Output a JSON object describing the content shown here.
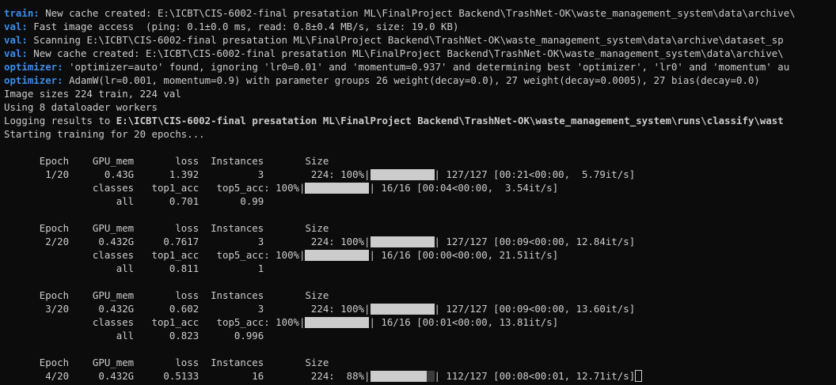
{
  "log": [
    {
      "prefix": "train:",
      "text": " New cache created: E:\\ICBT\\CIS-6002-final presatation ML\\FinalProject Backend\\TrashNet-OK\\waste_management_system\\data\\archive\\"
    },
    {
      "prefix": "val:",
      "text": " Fast image access  (ping: 0.1±0.0 ms, read: 0.8±0.4 MB/s, size: 19.0 KB)"
    },
    {
      "prefix": "val:",
      "text": " Scanning E:\\ICBT\\CIS-6002-final presatation ML\\FinalProject Backend\\TrashNet-OK\\waste_management_system\\data\\archive\\dataset_sp"
    },
    {
      "prefix": "val:",
      "text": " New cache created: E:\\ICBT\\CIS-6002-final presatation ML\\FinalProject Backend\\TrashNet-OK\\waste_management_system\\data\\archive\\"
    },
    {
      "prefix": "optimizer:",
      "text": " 'optimizer=auto' found, ignoring 'lr0=0.01' and 'momentum=0.937' and determining best 'optimizer', 'lr0' and 'momentum' au"
    },
    {
      "prefix": "optimizer:",
      "text": " AdamW(lr=0.001, momentum=0.9) with parameter groups 26 weight(decay=0.0), 27 weight(decay=0.0005), 27 bias(decay=0.0)"
    },
    {
      "prefix": "",
      "text": "Image sizes 224 train, 224 val"
    },
    {
      "prefix": "",
      "text": "Using 8 dataloader workers"
    },
    {
      "prefix": "",
      "text": "Logging results to ",
      "bold": "E:\\ICBT\\CIS-6002-final presatation ML\\FinalProject Backend\\TrashNet-OK\\waste_management_system\\runs\\classify\\wast"
    },
    {
      "prefix": "",
      "text": "Starting training for 20 epochs..."
    }
  ],
  "epochs": [
    {
      "header": "      Epoch    GPU_mem       loss  Instances       Size",
      "train_left": "       1/20      0.43G      1.392          3        224: 100%|",
      "train_progress": 1.0,
      "train_right": "| 127/127 [00:21<00:00,  5.79it/s]",
      "val_left": "               classes   top1_acc   top5_acc: 100%|",
      "val_progress": 1.0,
      "val_right": "| 16/16 [00:04<00:00,  3.54it/s]",
      "metrics": "                   all      0.701       0.99"
    },
    {
      "header": "      Epoch    GPU_mem       loss  Instances       Size",
      "train_left": "       2/20     0.432G     0.7617          3        224: 100%|",
      "train_progress": 1.0,
      "train_right": "| 127/127 [00:09<00:00, 12.84it/s]",
      "val_left": "               classes   top1_acc   top5_acc: 100%|",
      "val_progress": 1.0,
      "val_right": "| 16/16 [00:00<00:00, 21.51it/s]",
      "metrics": "                   all      0.811          1"
    },
    {
      "header": "      Epoch    GPU_mem       loss  Instances       Size",
      "train_left": "       3/20     0.432G      0.602          3        224: 100%|",
      "train_progress": 1.0,
      "train_right": "| 127/127 [00:09<00:00, 13.60it/s]",
      "val_left": "               classes   top1_acc   top5_acc: 100%|",
      "val_progress": 1.0,
      "val_right": "| 16/16 [00:01<00:00, 13.81it/s]",
      "metrics": "                   all      0.823      0.996"
    },
    {
      "header": "      Epoch    GPU_mem       loss  Instances       Size",
      "train_left": "       4/20     0.432G     0.5133         16        224:  88%|",
      "train_progress": 0.88,
      "train_right": "| 112/127 [00:08<00:01, 12.71it/s]"
    }
  ],
  "colors": {
    "prefix": "#3b8eea",
    "text": "#cccccc",
    "background": "#0c0c0c",
    "bar_fill": "#cccccc"
  }
}
